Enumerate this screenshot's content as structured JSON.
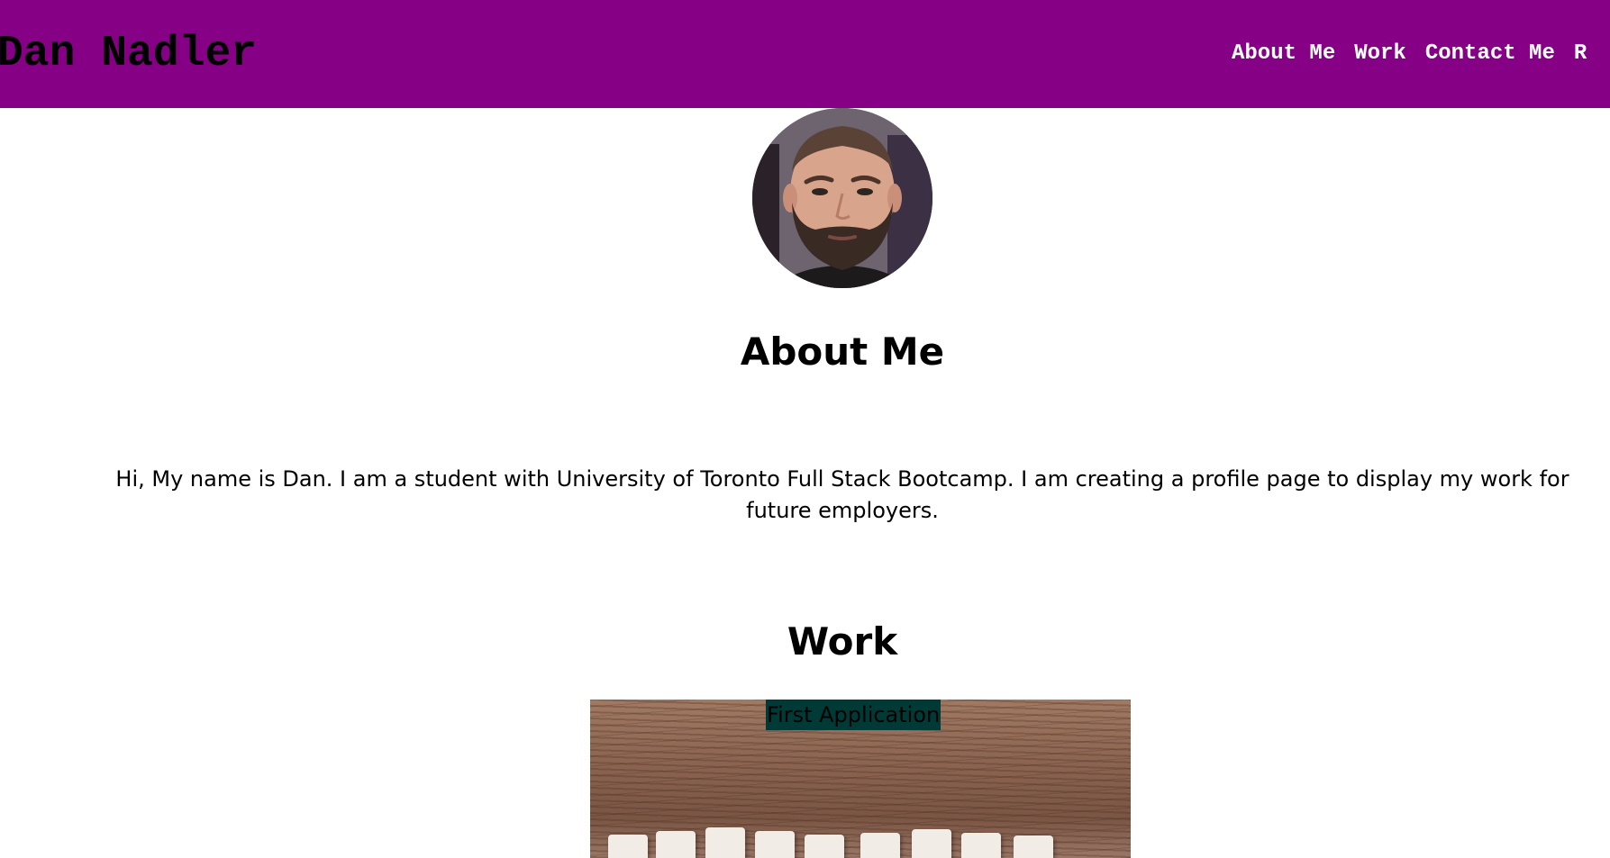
{
  "header": {
    "site_name": "Dan Nadler",
    "background_color": "#850085",
    "nav": [
      {
        "label": "About Me"
      },
      {
        "label": "Work"
      },
      {
        "label": "Contact Me"
      },
      {
        "label": "R"
      }
    ]
  },
  "avatar": {
    "icon": "profile-photo"
  },
  "about": {
    "heading": "About Me",
    "text": "Hi, My name is Dan. I am a student with University of Toronto Full Stack Bootcamp. I am creating a profile page to display my work for future employers."
  },
  "work": {
    "heading": "Work",
    "projects": [
      {
        "title": "First Application",
        "title_bg_color": "#003a36"
      }
    ]
  }
}
